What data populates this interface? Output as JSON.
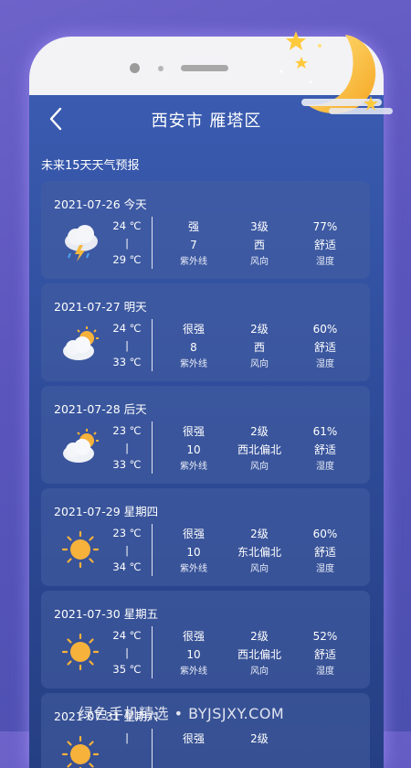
{
  "header": {
    "title": "西安市  雁塔区"
  },
  "section_title": "未来15天天气预报",
  "labels": {
    "uv": "紫外线",
    "wind": "风向",
    "humidity": "湿度",
    "sep": "|"
  },
  "days": [
    {
      "date": "2021-07-26  今天",
      "icon": "thunderstorm-icon",
      "low": "24 ℃",
      "high": "29 ℃",
      "uv_level": "强",
      "uv_index": "7",
      "wind_level": "3级",
      "wind_dir": "西",
      "humidity": "77%",
      "comfort": "舒适"
    },
    {
      "date": "2021-07-27  明天",
      "icon": "partly-cloudy-icon",
      "low": "24 ℃",
      "high": "33 ℃",
      "uv_level": "很强",
      "uv_index": "8",
      "wind_level": "2级",
      "wind_dir": "西",
      "humidity": "60%",
      "comfort": "舒适"
    },
    {
      "date": "2021-07-28  后天",
      "icon": "partly-cloudy-icon",
      "low": "23 ℃",
      "high": "33 ℃",
      "uv_level": "很强",
      "uv_index": "10",
      "wind_level": "2级",
      "wind_dir": "西北偏北",
      "humidity": "61%",
      "comfort": "舒适"
    },
    {
      "date": "2021-07-29  星期四",
      "icon": "sunny-icon",
      "low": "23 ℃",
      "high": "34 ℃",
      "uv_level": "很强",
      "uv_index": "10",
      "wind_level": "2级",
      "wind_dir": "东北偏北",
      "humidity": "60%",
      "comfort": "舒适"
    },
    {
      "date": "2021-07-30  星期五",
      "icon": "sunny-icon",
      "low": "24 ℃",
      "high": "35 ℃",
      "uv_level": "很强",
      "uv_index": "10",
      "wind_level": "2级",
      "wind_dir": "西北偏北",
      "humidity": "52%",
      "comfort": "舒适"
    },
    {
      "date": "2021-07-31  星期六",
      "icon": "sunny-icon",
      "low": "",
      "high": "",
      "uv_level": "很强",
      "uv_index": "",
      "wind_level": "2级",
      "wind_dir": "",
      "humidity": "",
      "comfort": ""
    }
  ],
  "watermark": "绿色手机精选 • BYJSJXY.COM",
  "colors": {
    "screen_top": "#3a5bb0",
    "screen_bottom": "#263f84",
    "background": "#5a55bd",
    "sun": "#f7b23b"
  }
}
